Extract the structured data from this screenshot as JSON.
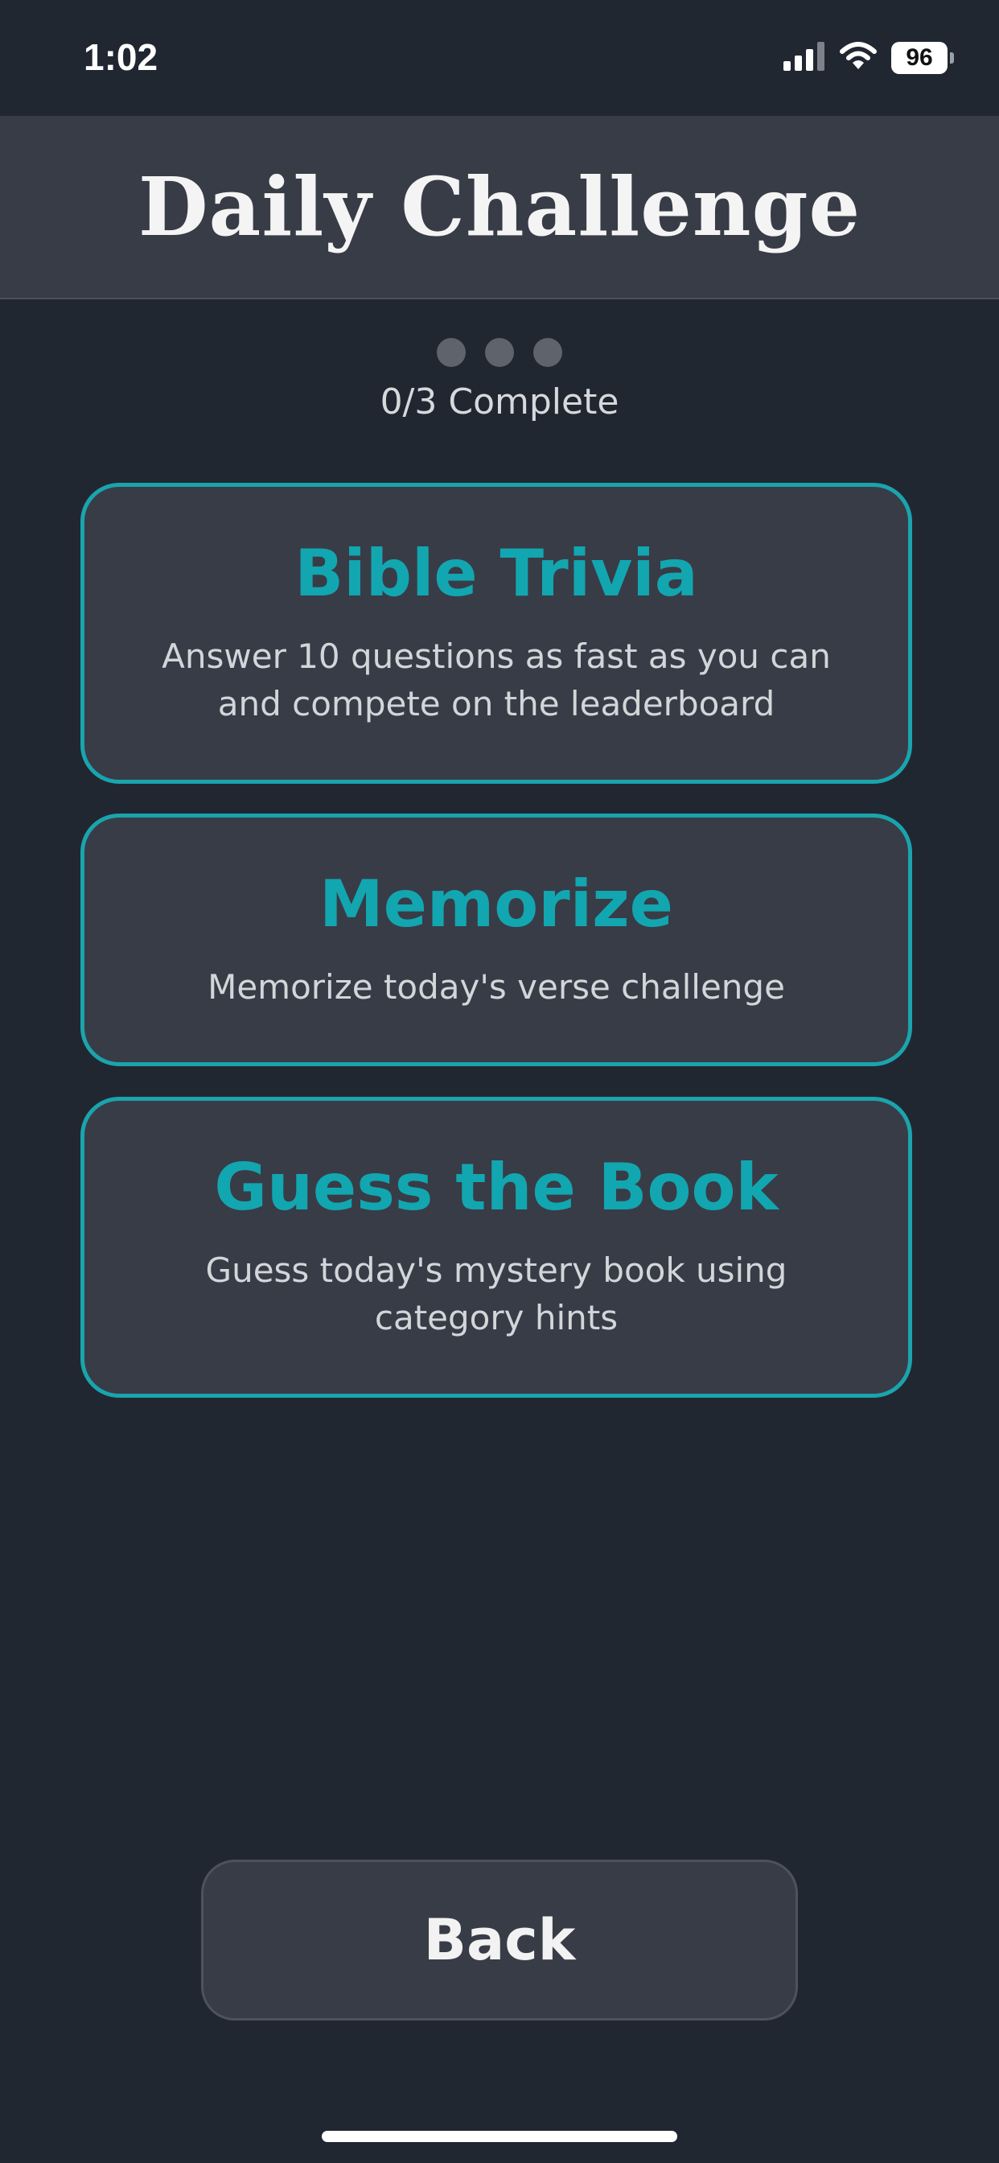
{
  "status_bar": {
    "time": "1:02",
    "battery": "96",
    "icons": [
      "signal-icon",
      "wifi-icon",
      "battery-icon"
    ]
  },
  "header": {
    "title": "Daily Challenge"
  },
  "progress": {
    "completed": 0,
    "total": 3,
    "label": "0/3 Complete"
  },
  "challenges": [
    {
      "title": "Bible Trivia",
      "description": "Answer 10 questions as fast as you can and compete on the leaderboard"
    },
    {
      "title": "Memorize",
      "description": "Memorize today's verse challenge"
    },
    {
      "title": "Guess the Book",
      "description": "Guess today's mystery book using category hints"
    }
  ],
  "footer": {
    "back_label": "Back"
  },
  "colors": {
    "background": "#212731",
    "surface": "#383c47",
    "accent": "#12a6b0",
    "dot_inactive": "#5f636c"
  }
}
